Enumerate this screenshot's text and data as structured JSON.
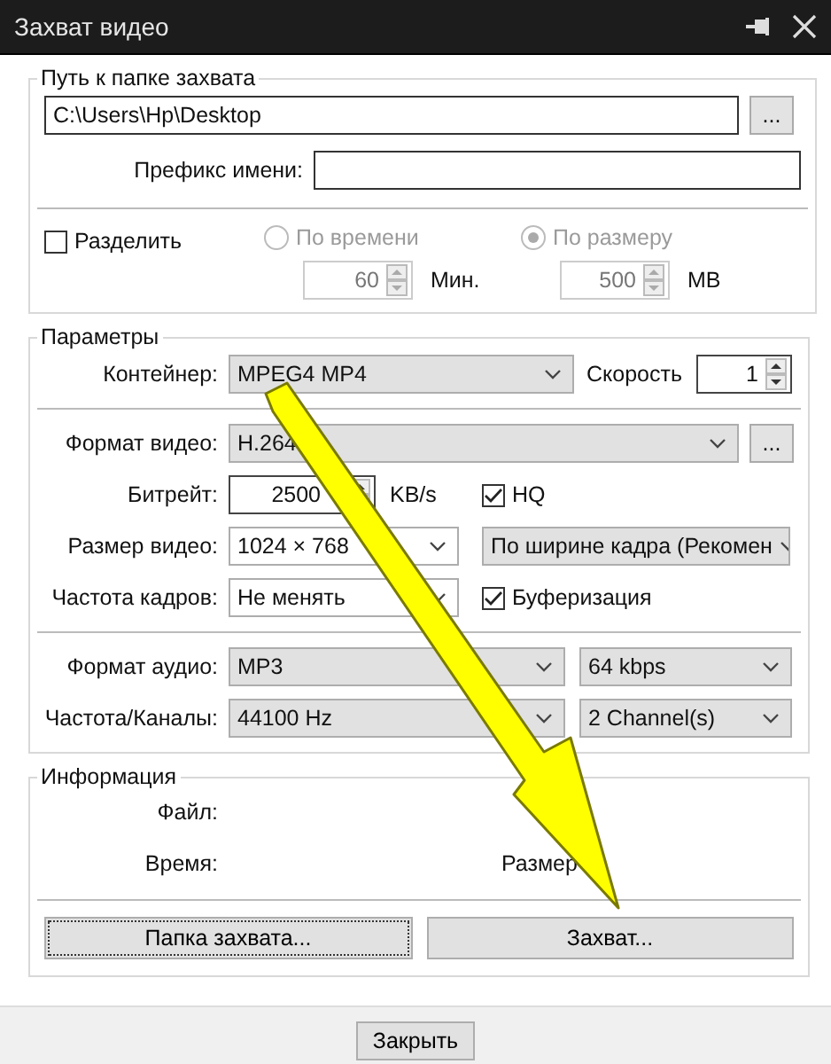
{
  "window": {
    "title": "Захват видео"
  },
  "capture_path": {
    "legend": "Путь к папке захвата",
    "path": "C:\\Users\\Hp\\Desktop",
    "browse": "...",
    "prefix_label": "Префикс имени:"
  },
  "split": {
    "label": "Разделить",
    "checked": false,
    "options": [
      {
        "label": "По времени",
        "selected": false,
        "value": "60",
        "unit": "Мин."
      },
      {
        "label": "По размеру",
        "selected": true,
        "value": "500",
        "unit": "MB"
      }
    ]
  },
  "parameters": {
    "legend": "Параметры",
    "container_label": "Контейнер:",
    "container": "MPEG4 MP4",
    "speed_label": "Скорость",
    "speed": "1",
    "video_format_label": "Формат видео:",
    "video_format": "H.264",
    "video_browse": "...",
    "bitrate_label": "Битрейт:",
    "bitrate": "2500",
    "bitrate_unit": "KB/s",
    "hq": {
      "label": "HQ",
      "checked": true
    },
    "video_size_label": "Размер видео:",
    "video_size": "1024 × 768",
    "scaling": "По ширине кадра (Рекомен",
    "frame_rate_label": "Частота кадров:",
    "frame_rate": "Не менять",
    "buffering": {
      "label": "Буферизация",
      "checked": true
    },
    "audio_format_label": "Формат аудио:",
    "audio_format": "MP3",
    "audio_bitrate": "64 kbps",
    "rate_channels_label": "Частота/Каналы:",
    "sample_rate": "44100 Hz",
    "channels": "2 Channel(s)"
  },
  "info": {
    "legend": "Информация",
    "file_label": "Файл:",
    "time_label": "Время:",
    "size_label": "Размер",
    "buttons": [
      "Папка захвата...",
      "Захват..."
    ]
  },
  "footer": {
    "close": "Закрыть"
  }
}
